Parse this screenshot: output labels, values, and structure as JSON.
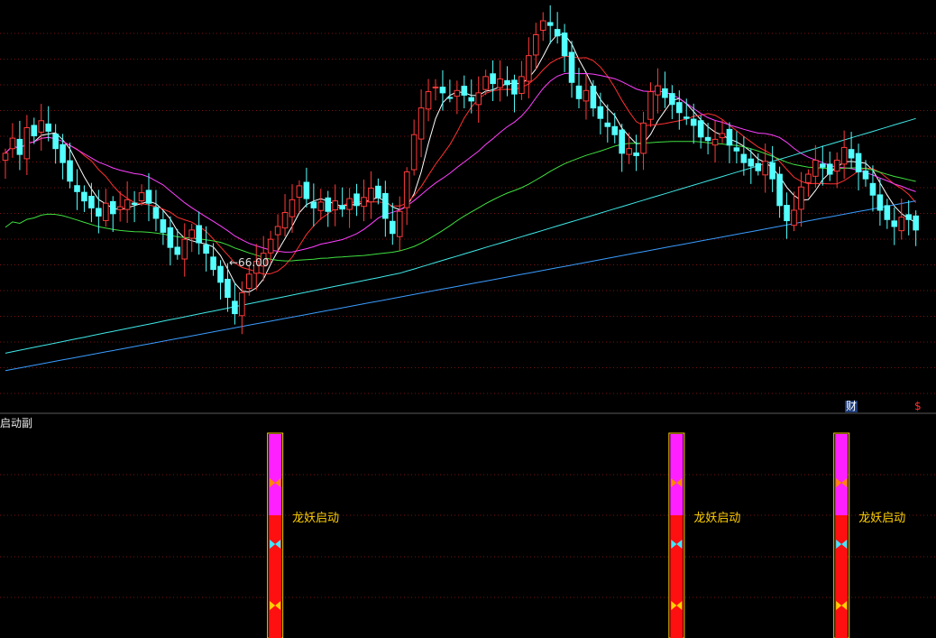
{
  "panel": {
    "sub_label": "启动副",
    "tag_cai": "财",
    "tag_s": "$"
  },
  "chart_data": {
    "type": "candlestick",
    "price_low_annotation": "←66.00",
    "colors": {
      "up": "#ff3a3a",
      "down": "#54ffff",
      "ma5": "#ffffff",
      "ma10": "#ff3030",
      "ma20": "#ff40ff",
      "ma60": "#40e040",
      "ma120": "#40e8e8",
      "ma250": "#3a9cff",
      "grid": "#7a1010",
      "signal_magenta": "#ff20ff",
      "signal_red": "#ff1010",
      "signal_text": "#ffd000"
    },
    "closes": [
      80.2,
      81.5,
      80.1,
      82.4,
      81.7,
      83.0,
      82.1,
      80.6,
      79.4,
      77.8,
      76.9,
      76.1,
      75.5,
      74.8,
      75.9,
      75.0,
      75.6,
      76.2,
      75.8,
      76.8,
      75.9,
      74.6,
      73.4,
      72.1,
      71.5,
      72.8,
      73.6,
      72.5,
      71.6,
      70.2,
      69.1,
      67.8,
      66.4,
      68.2,
      69.8,
      70.9,
      71.6,
      72.8,
      73.9,
      75.1,
      76.2,
      77.4,
      76.3,
      75.5,
      76.0,
      75.2,
      76.1,
      75.4,
      76.3,
      75.7,
      76.4,
      77.2,
      76.4,
      74.6,
      73.3,
      75.2,
      78.6,
      81.8,
      84.1,
      85.5,
      85.9,
      85.4,
      85.0,
      85.6,
      85.2,
      84.7,
      85.4,
      86.8,
      86.2,
      86.6,
      86.1,
      85.3,
      86.8,
      88.6,
      90.4,
      91.6,
      91.2,
      90.3,
      88.6,
      86.3,
      84.9,
      85.6,
      84.1,
      83.2,
      82.5,
      81.8,
      80.2,
      80.6,
      80.0,
      82.8,
      85.5,
      86.0,
      85.0,
      84.4,
      83.7,
      83.2,
      82.6,
      81.6,
      81.3,
      81.4,
      81.9,
      80.9,
      80.4,
      79.4,
      79.1,
      78.7,
      79.5,
      78.0,
      75.7,
      74.4,
      75.3,
      77.3,
      78.4,
      79.6,
      79.0,
      78.4,
      79.6,
      80.7,
      79.8,
      78.6,
      78.0,
      76.6,
      75.3,
      74.5,
      73.9,
      74.7,
      74.5,
      73.6
    ],
    "signals": [
      {
        "label": "龙妖启动"
      },
      {
        "label": "龙妖启动"
      },
      {
        "label": "龙妖启动"
      }
    ]
  }
}
